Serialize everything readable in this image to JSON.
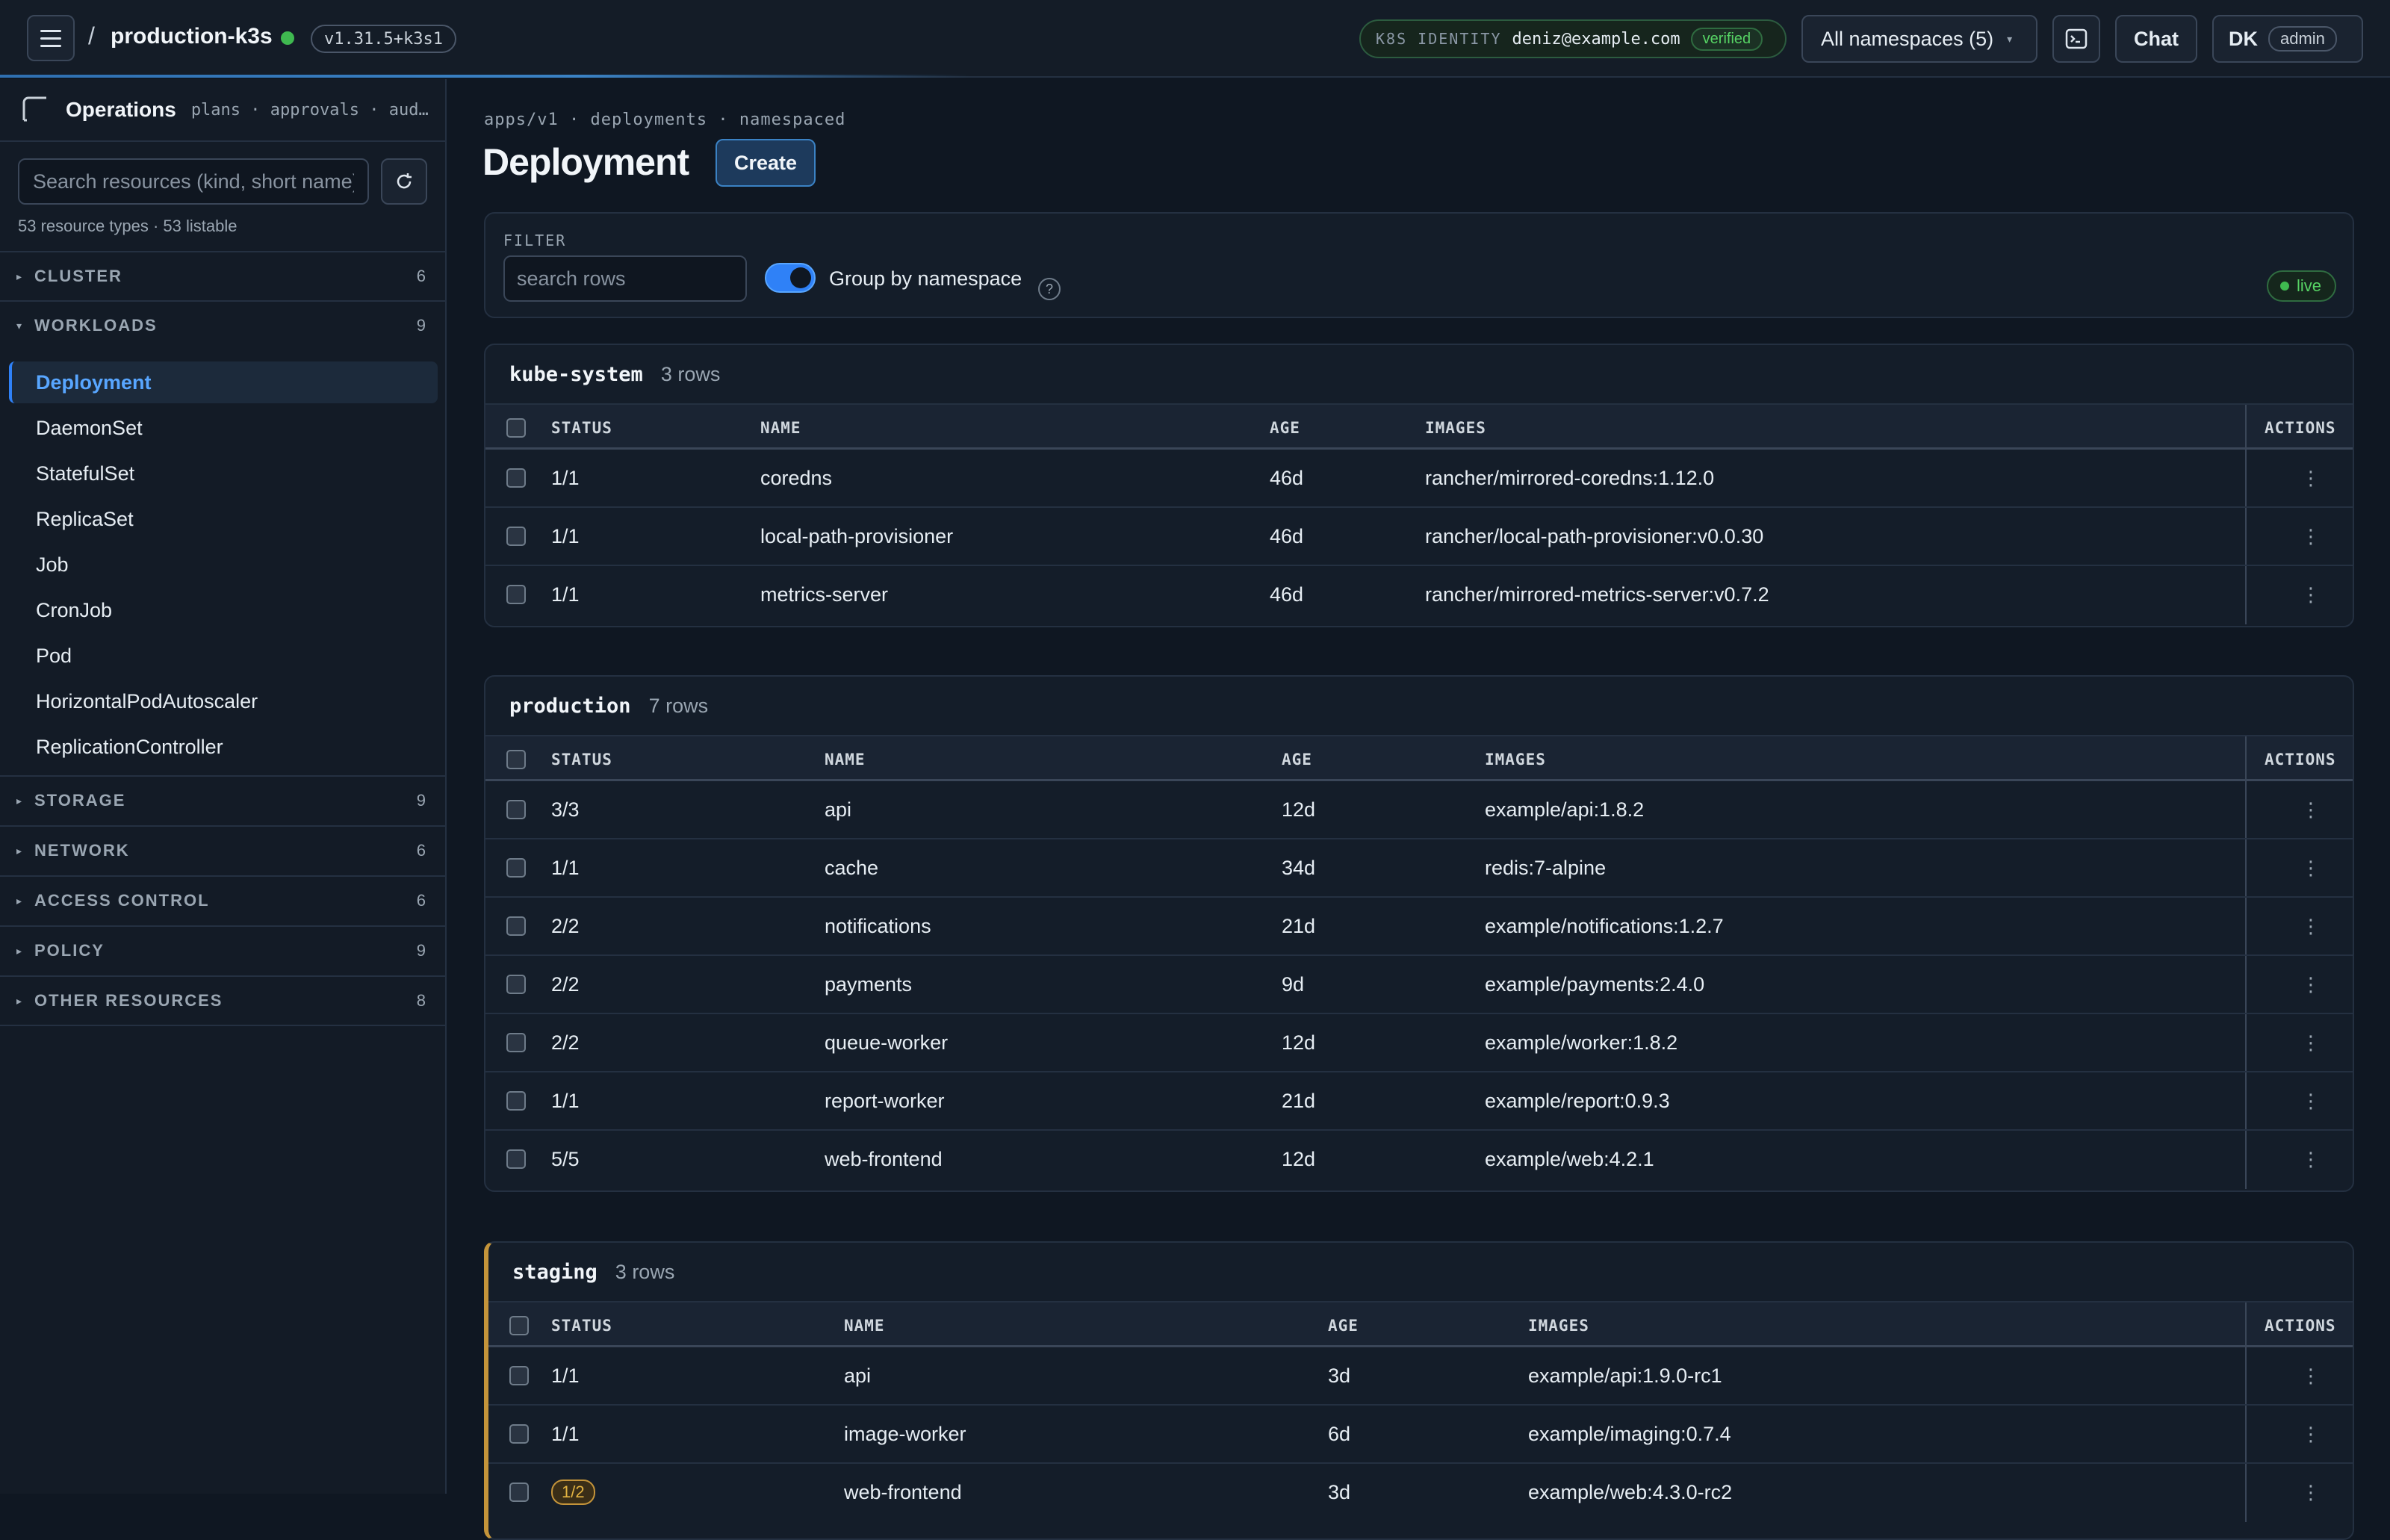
{
  "topbar": {
    "crumb_sep": "/",
    "cluster": "production-k3s",
    "version": "v1.31.5+k3s1",
    "identity_label": "K8S IDENTITY",
    "identity_user": "deniz@example.com",
    "identity_status": "verified",
    "namespace_select": "All namespaces (5)",
    "chat": "Chat",
    "user_initials": "DK",
    "user_role": "admin"
  },
  "sidebar": {
    "title": "Operations",
    "subtitle": "plans · approvals · audit",
    "search_placeholder": "Search resources (kind, short name)",
    "count": "53 resource types · 53 listable",
    "sections": [
      {
        "label": "CLUSTER",
        "count": "6"
      },
      {
        "label": "WORKLOADS",
        "count": "9"
      },
      {
        "label": "STORAGE",
        "count": "9"
      },
      {
        "label": "NETWORK",
        "count": "6"
      },
      {
        "label": "ACCESS CONTROL",
        "count": "6"
      },
      {
        "label": "POLICY",
        "count": "9"
      },
      {
        "label": "OTHER RESOURCES",
        "count": "8"
      }
    ],
    "workloads": [
      "Deployment",
      "DaemonSet",
      "StatefulSet",
      "ReplicaSet",
      "Job",
      "CronJob",
      "Pod",
      "HorizontalPodAutoscaler",
      "ReplicationController"
    ]
  },
  "main": {
    "api": "apps/v1 · deployments · namespaced",
    "title": "Deployment",
    "create": "Create",
    "filter_label": "FILTER",
    "filter_placeholder": "search rows",
    "group_toggle": "Group by namespace",
    "help": "?",
    "live": "live",
    "columns": {
      "status": "STATUS",
      "name": "NAME",
      "age": "AGE",
      "images": "IMAGES",
      "actions": "ACTIONS"
    },
    "groups": [
      {
        "namespace": "kube-system",
        "rows_label": "3 rows",
        "rows": [
          {
            "status": "1/1",
            "name": "coredns",
            "age": "46d",
            "image": "rancher/mirrored-coredns:1.12.0"
          },
          {
            "status": "1/1",
            "name": "local-path-provisioner",
            "age": "46d",
            "image": "rancher/local-path-provisioner:v0.0.30"
          },
          {
            "status": "1/1",
            "name": "metrics-server",
            "age": "46d",
            "image": "rancher/mirrored-metrics-server:v0.7.2"
          }
        ]
      },
      {
        "namespace": "production",
        "rows_label": "7 rows",
        "rows": [
          {
            "status": "3/3",
            "name": "api",
            "age": "12d",
            "image": "example/api:1.8.2"
          },
          {
            "status": "1/1",
            "name": "cache",
            "age": "34d",
            "image": "redis:7-alpine"
          },
          {
            "status": "2/2",
            "name": "notifications",
            "age": "21d",
            "image": "example/notifications:1.2.7"
          },
          {
            "status": "2/2",
            "name": "payments",
            "age": "9d",
            "image": "example/payments:2.4.0"
          },
          {
            "status": "2/2",
            "name": "queue-worker",
            "age": "12d",
            "image": "example/worker:1.8.2"
          },
          {
            "status": "1/1",
            "name": "report-worker",
            "age": "21d",
            "image": "example/report:0.9.3"
          },
          {
            "status": "5/5",
            "name": "web-frontend",
            "age": "12d",
            "image": "example/web:4.2.1"
          }
        ]
      },
      {
        "namespace": "staging",
        "rows_label": "3 rows",
        "rows": [
          {
            "status": "1/1",
            "name": "api",
            "age": "3d",
            "image": "example/api:1.9.0-rc1"
          },
          {
            "status": "1/1",
            "name": "image-worker",
            "age": "6d",
            "image": "example/imaging:0.7.4"
          },
          {
            "status": "1/2",
            "name": "web-frontend",
            "age": "3d",
            "image": "example/web:4.3.0-rc2"
          }
        ]
      }
    ]
  }
}
